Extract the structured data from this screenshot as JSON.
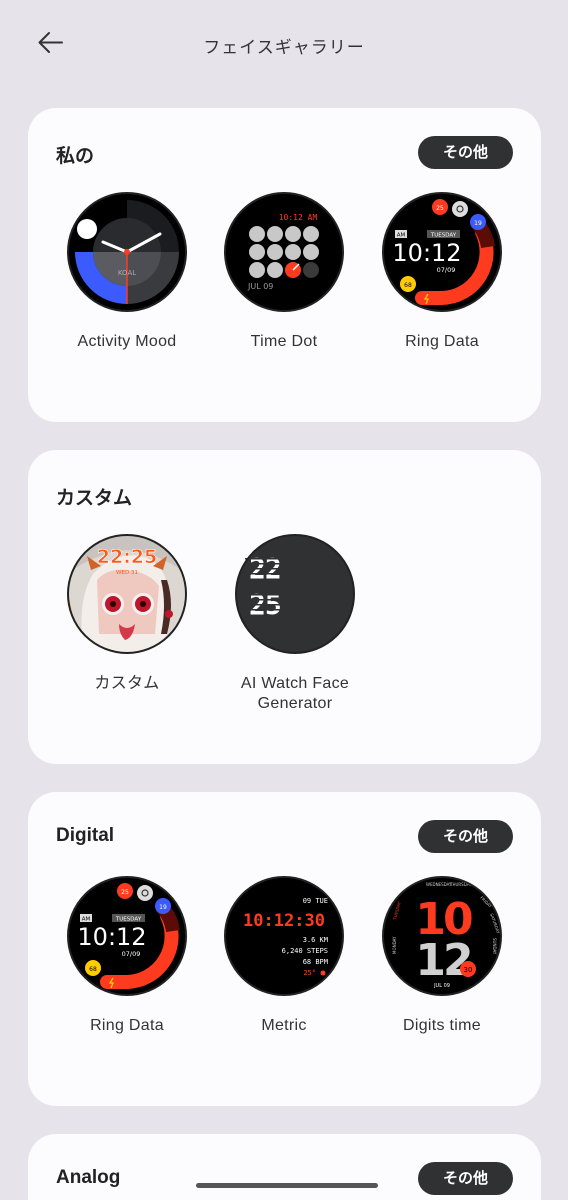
{
  "header": {
    "title": "フェイスギャラリー"
  },
  "sections": {
    "mine": {
      "title": "私の",
      "more": "その他",
      "faces": [
        {
          "label": "Activity Mood",
          "text": "KOAL"
        },
        {
          "label": "Time Dot",
          "time": "10:12 AM",
          "date": "JUL 09"
        },
        {
          "label": "Ring Data",
          "ampm": "AM",
          "day": "TUESDAY",
          "time": "10:12",
          "date": "07/09",
          "c1": "25",
          "c2": "19",
          "c3": "68"
        }
      ]
    },
    "custom": {
      "title": "カスタム",
      "faces": [
        {
          "label": "カスタム",
          "time": "22:25",
          "date": "WED 31"
        },
        {
          "label_line1": "AI Watch Face",
          "label_line2": "Generator",
          "h": "22",
          "m": "25"
        }
      ]
    },
    "digital": {
      "title": "Digital",
      "more": "その他",
      "faces": [
        {
          "label": "Ring Data",
          "ampm": "AM",
          "day": "TUESDAY",
          "time": "10:12",
          "date": "07/09",
          "c1": "25",
          "c2": "19",
          "c3": "68"
        },
        {
          "label": "Metric",
          "date": "09 TUE",
          "time": "10:12:30",
          "km": "3.6 KM",
          "steps": "6,240 STEPS",
          "bpm": "68 BPM",
          "temp": "25°"
        },
        {
          "label": "Digits time",
          "h": "10",
          "m": "12",
          "num": "30",
          "date": "JUL 09",
          "days": [
            "TUESDAY",
            "WEDNESDAY",
            "THURSDAY",
            "FRIDAY",
            "SATURDAY",
            "SUNDAY",
            "MONDAY"
          ]
        }
      ]
    },
    "analog": {
      "title": "Analog",
      "more": "その他"
    }
  },
  "colors": {
    "accent": "#ff3b1f",
    "blue": "#3b5bff",
    "yellow": "#ffcc00",
    "dark": "#303133"
  },
  "icons": {
    "back": "arrow-left-icon"
  }
}
